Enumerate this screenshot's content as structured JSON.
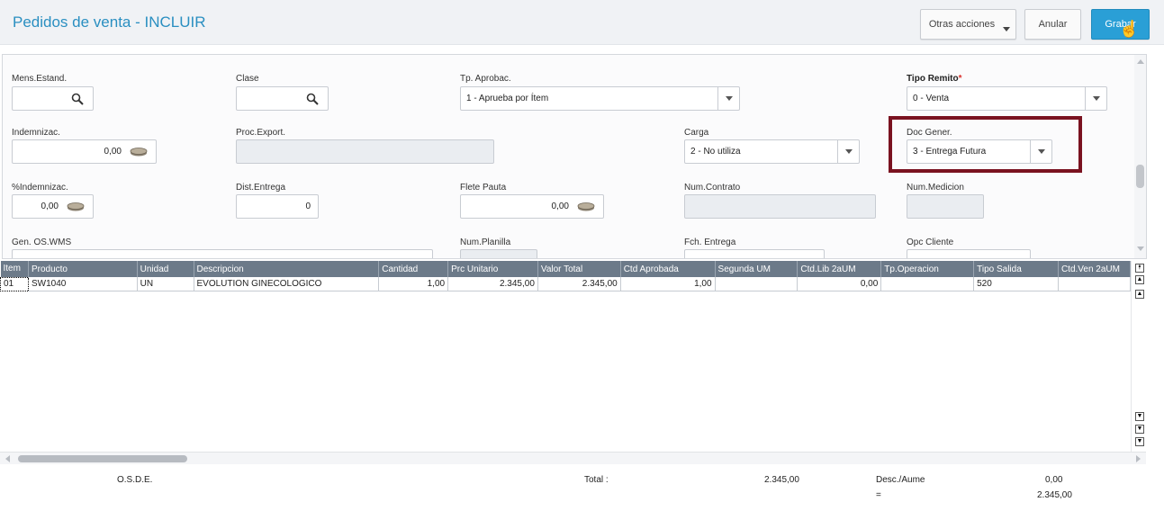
{
  "header": {
    "title": "Pedidos de venta - INCLUIR",
    "buttons": {
      "otras_acciones": "Otras acciones",
      "anular": "Anular",
      "grabar": "Grabar"
    }
  },
  "form": {
    "mens_estand": {
      "label": "Mens.Estand.",
      "value": ""
    },
    "clase": {
      "label": "Clase",
      "value": ""
    },
    "tp_aprobac": {
      "label": "Tp. Aprobac.",
      "value": "1 - Aprueba por Ítem"
    },
    "tipo_remito": {
      "label": "Tipo Remito",
      "required_mark": "*",
      "value": "0 - Venta"
    },
    "indemnizac": {
      "label": "Indemnizac.",
      "value": "0,00"
    },
    "proc_export": {
      "label": "Proc.Export.",
      "value": ""
    },
    "carga": {
      "label": "Carga",
      "value": "2 - No utiliza"
    },
    "doc_gener": {
      "label": "Doc Gener.",
      "value": "3 - Entrega Futura"
    },
    "pct_indemnizac": {
      "label": "%Indemnizac.",
      "value": "0,00"
    },
    "dist_entrega": {
      "label": "Dist.Entrega",
      "value": "0"
    },
    "flete_pauta": {
      "label": "Flete Pauta",
      "value": "0,00"
    },
    "num_contrato": {
      "label": "Num.Contrato",
      "value": ""
    },
    "num_medicion": {
      "label": "Num.Medicion",
      "value": ""
    },
    "gen_os_wms": {
      "label": "Gen. OS.WMS"
    },
    "num_planilla": {
      "label": "Num.Planilla"
    },
    "fch_entrega": {
      "label": "Fch. Entrega"
    },
    "opc_cliente": {
      "label": "Opc Cliente"
    }
  },
  "grid": {
    "columns": [
      "Item",
      "Producto",
      "Unidad",
      "Descripcion",
      "Cantidad",
      "Prc Unitario",
      "Valor Total",
      "Ctd Aprobada",
      "Segunda UM",
      "Ctd.Lib 2aUM",
      "Tp.Operacion",
      "Tipo Salida",
      "Ctd.Ven 2aUM"
    ],
    "rows": [
      [
        "01",
        "SW1040",
        "UN",
        "EVOLUTION GINECOLOGICO",
        "1,00",
        "2.345,00",
        "2.345,00",
        "1,00",
        "",
        "0,00",
        "",
        "520",
        ""
      ]
    ]
  },
  "footer": {
    "client": "O.S.D.E.",
    "total_label": "Total :",
    "total_value": "2.345,00",
    "desc_label": "Desc./Aume",
    "desc_value": "0,00",
    "eq_label": "=",
    "eq_value": "2.345,00"
  },
  "colors": {
    "title": "#2a8fc1",
    "primary_button": "#2a9fd6",
    "grid_header": "#6c7a89",
    "highlight_box": "#7a1220"
  },
  "icons": [
    "search-icon",
    "coins-icon",
    "chevron-down-icon",
    "hand-cursor-icon"
  ]
}
